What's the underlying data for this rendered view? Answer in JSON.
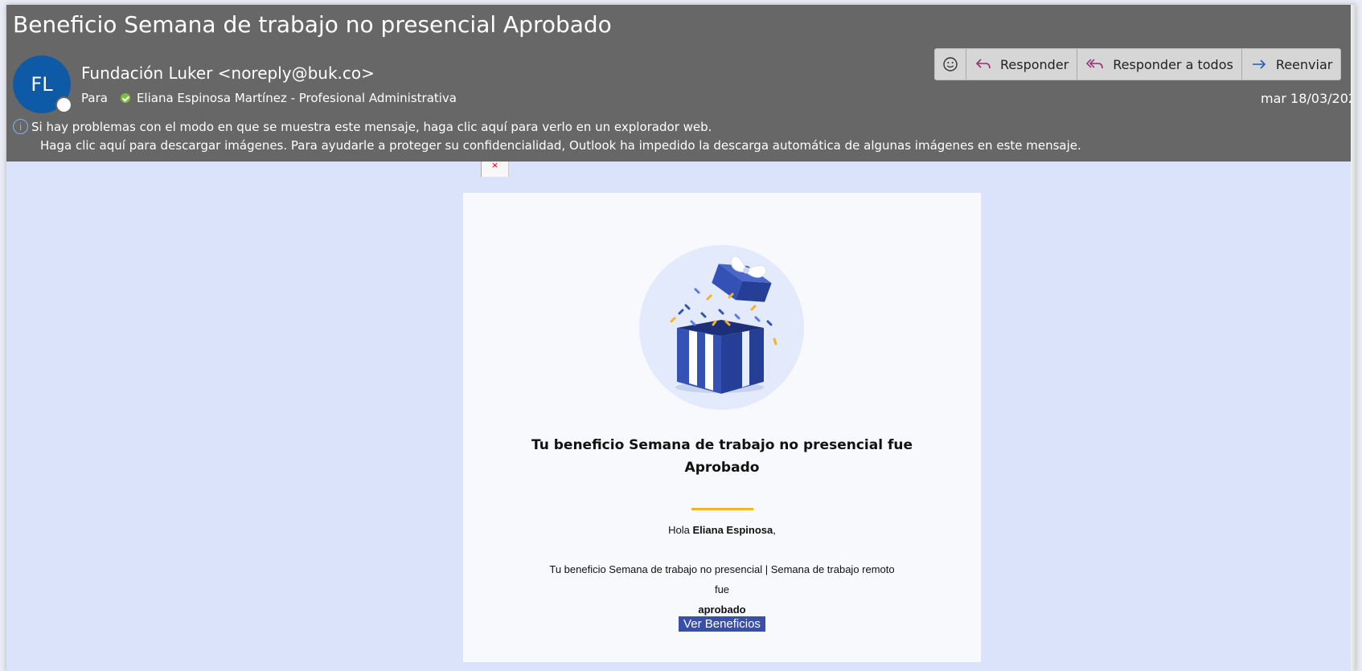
{
  "email": {
    "subject": "Beneficio Semana de trabajo no presencial Aprobado",
    "avatar_initials": "FL",
    "sender": "Fundación Luker <noreply@buk.co>",
    "to_label": "Para",
    "to_recipient": "Eliana Espinosa Martínez - Profesional Administrativa",
    "date": "mar 18/03/202",
    "info_line": "Si hay problemas con el modo en que se muestra este mensaje, haga clic aquí para verlo en un explorador web.",
    "images_line": "Haga clic aquí para descargar imágenes. Para ayudarle a proteger su confidencialidad, Outlook ha impedido la descarga automática de algunas imágenes en este mensaje."
  },
  "actions": {
    "emoji_icon": "smiley-icon",
    "reply": "Responder",
    "reply_all": "Responder a todos",
    "forward": "Reenviar"
  },
  "body": {
    "title_line1": "Tu beneficio Semana de trabajo no presencial fue",
    "title_line2": "Aprobado",
    "greeting_prefix": "Hola ",
    "greeting_name": "Eliana Espinosa",
    "greeting_suffix": ",",
    "text_line1": "Tu beneficio Semana de trabajo no presencial | Semana de trabajo remoto",
    "text_line2_prefix": "fue ",
    "text_line2_bold": "aprobado",
    "cta": "Ver Beneficios"
  },
  "colors": {
    "header_bg": "#676767",
    "reading_bg": "#dbe3fa",
    "card_bg": "#f7f9fc",
    "avatar_bg": "#0f5aa6",
    "accent_divider": "#f5b327",
    "gift_blue": "#2f4fb0",
    "link_highlight": "#3a4fa8"
  }
}
